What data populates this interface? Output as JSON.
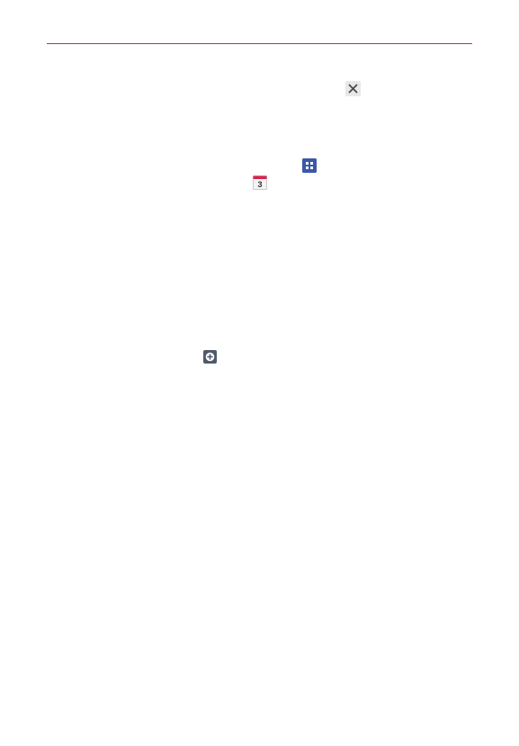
{
  "icons": {
    "close": "close-icon",
    "apps": "apps-icon",
    "calendar": "calendar-icon",
    "add": "add-circle-icon"
  },
  "calendar_icon_day": "3",
  "colors": {
    "rule": "#d3263a",
    "apps_icon_bg": "#3b57a8",
    "calendar_top": "#d9254d",
    "add_icon_bg": "#4e5a6a"
  }
}
